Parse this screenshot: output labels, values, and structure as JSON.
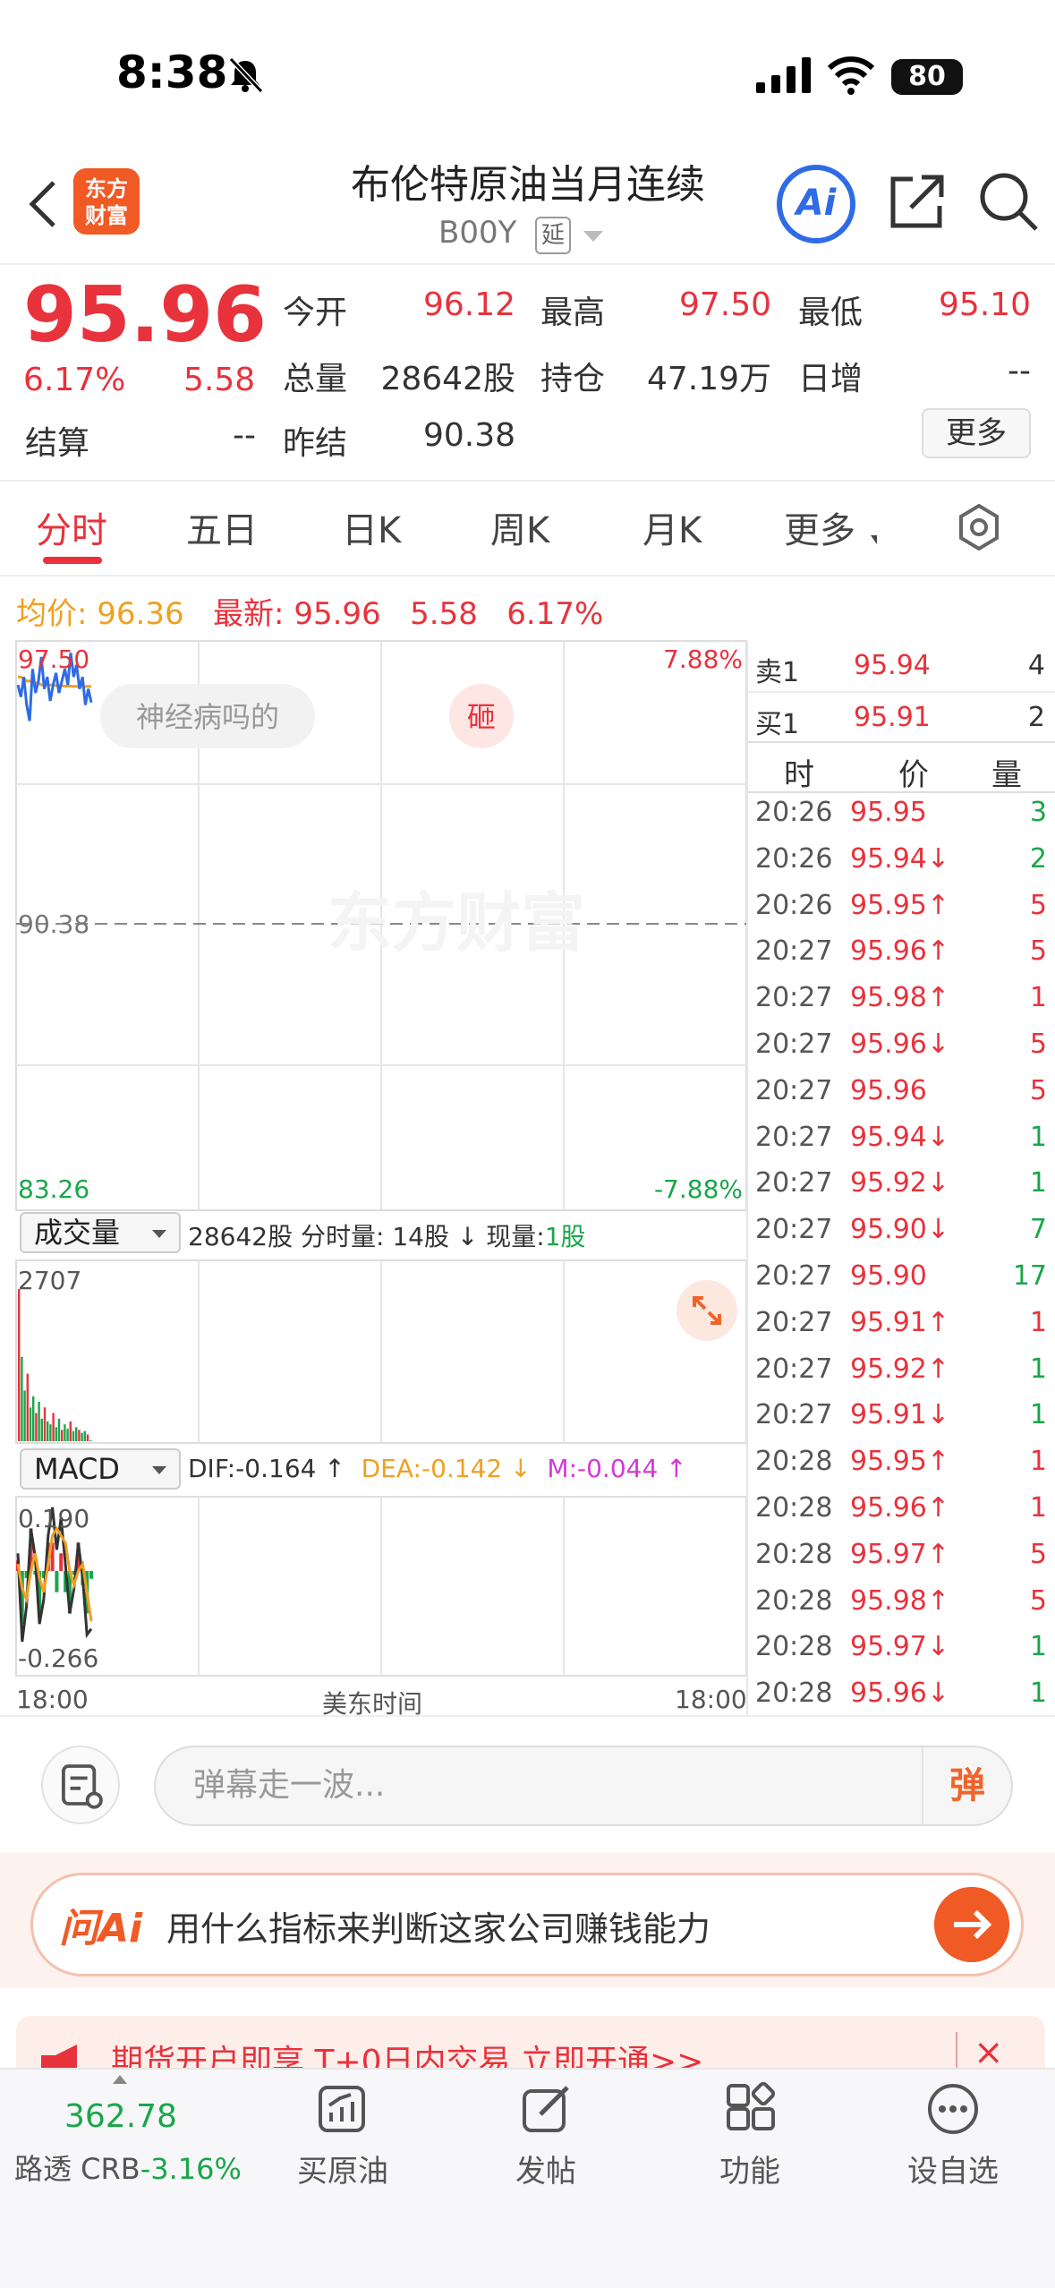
{
  "status": {
    "time": "8:38",
    "battery": "80"
  },
  "header": {
    "title": "布伦特原油当月连续",
    "code": "B00Y",
    "delay_badge": "延",
    "logo_line1": "东方",
    "logo_line2": "财富",
    "ai_label": "Ai"
  },
  "quote": {
    "price": "95.96",
    "change_pct": "6.17%",
    "change": "5.58",
    "fields": {
      "open_label": "今开",
      "open": "96.12",
      "high_label": "最高",
      "high": "97.50",
      "low_label": "最低",
      "low": "95.10",
      "volume_label": "总量",
      "volume": "28642股",
      "position_label": "持仓",
      "position": "47.19万",
      "daily_inc_label": "日增",
      "daily_inc": "--",
      "settle_label": "结算",
      "settle": "--",
      "prev_settle_label": "昨结",
      "prev_settle": "90.38"
    },
    "more_label": "更多"
  },
  "tabs": [
    "分时",
    "五日",
    "日K",
    "周K",
    "月K",
    "更多"
  ],
  "summary": {
    "avg_label": "均价:",
    "avg": "96.36",
    "latest_label": "最新:",
    "latest": "95.96",
    "change": "5.58",
    "change_pct": "6.17%"
  },
  "chart_labels": {
    "top_price": "97.50",
    "top_pct": "7.88%",
    "mid_price": "90.38",
    "bottom_price": "83.26",
    "bottom_pct": "-7.88%",
    "danmu_bubble_1": "神经病吗的",
    "danmu_bubble_2": "砸",
    "watermark": "东方财富",
    "vol_max": "2707",
    "macd_top": "0.190",
    "macd_bottom": "-0.266",
    "time_start": "18:00",
    "time_mid": "美东时间",
    "time_end": "18:00"
  },
  "volume_panel": {
    "selector": "成交量",
    "total": "28642股",
    "minute_label": "分时量:",
    "minute_vol": "14股",
    "arrow": "↓",
    "current_label": "现量:",
    "current_vol": "1股"
  },
  "macd_panel": {
    "selector": "MACD",
    "dif": "DIF:-0.164 ↑",
    "dea": "DEA:-0.142 ↓",
    "m": "M:-0.044 ↑"
  },
  "colors": {
    "up": "#e8323c",
    "down": "#1aa64a",
    "avg_line": "#f0a020",
    "price_line": "#2f6be6",
    "accent": "#f05a24"
  },
  "chart_data": {
    "type": "line",
    "title": "",
    "xlabel": "美东时间",
    "ylabel": "",
    "ylim": [
      83.26,
      97.5
    ],
    "x_ticks": [
      "18:00",
      "18:00"
    ],
    "series": [],
    "y_ticks": [
      "97.50",
      "90.38",
      "83.26"
    ],
    "pct_ticks": [
      "7.88%",
      "-7.88%"
    ],
    "price_path": [
      96.4,
      96.1,
      96.6,
      95.9,
      95.5,
      96.8,
      96.2,
      96.5,
      97.1,
      96.3,
      96.6,
      96.0,
      96.4,
      96.7,
      96.2,
      96.5,
      96.8,
      96.4,
      97.2,
      96.6,
      96.9,
      96.3,
      96.6,
      95.9,
      96.3,
      95.96
    ],
    "avg_path": [
      96.6,
      96.6,
      96.55,
      96.5,
      96.5,
      96.45,
      96.45,
      96.45,
      96.4,
      96.4,
      96.4,
      96.4,
      96.4,
      96.38,
      96.38,
      96.38,
      96.37,
      96.37,
      96.37,
      96.36,
      96.36,
      96.36,
      96.36,
      96.36,
      96.36,
      96.36
    ],
    "volume_path": [
      2707,
      1500,
      900,
      1200,
      600,
      800,
      500,
      700,
      400,
      600,
      350,
      300,
      500,
      250,
      400,
      200,
      300,
      220,
      350,
      180,
      250,
      200,
      150,
      180,
      120,
      14
    ],
    "volume_max": 2707,
    "macd_ylim": [
      -0.266,
      0.19
    ],
    "macd_dif": [
      0.05,
      -0.2,
      -0.1,
      0.12,
      0.04,
      -0.15,
      -0.08,
      0.1,
      0.18,
      0.06,
      0.15,
      0.02,
      -0.12,
      -0.05,
      0.08,
      -0.02,
      -0.18,
      -0.164
    ],
    "macd_dea": [
      0.02,
      -0.05,
      -0.08,
      0.0,
      0.05,
      -0.02,
      -0.06,
      0.02,
      0.1,
      0.12,
      0.1,
      0.08,
      0.0,
      -0.04,
      0.0,
      0.02,
      -0.06,
      -0.142
    ]
  },
  "order_book": {
    "ask_label": "卖1",
    "ask_price": "95.94",
    "ask_vol": "4",
    "bid_label": "买1",
    "bid_price": "95.91",
    "bid_vol": "2"
  },
  "ticks_header": {
    "time": "时",
    "price": "价",
    "vol": "量"
  },
  "ticks": [
    {
      "time": "20:26",
      "price": "95.95",
      "vol": "3",
      "dir": "",
      "vol_color": "green"
    },
    {
      "time": "20:26",
      "price": "95.94↓",
      "vol": "2",
      "dir": "down",
      "vol_color": "green"
    },
    {
      "time": "20:26",
      "price": "95.95↑",
      "vol": "5",
      "dir": "up",
      "vol_color": "red"
    },
    {
      "time": "20:27",
      "price": "95.96↑",
      "vol": "5",
      "dir": "up",
      "vol_color": "red"
    },
    {
      "time": "20:27",
      "price": "95.98↑",
      "vol": "1",
      "dir": "up",
      "vol_color": "red"
    },
    {
      "time": "20:27",
      "price": "95.96↓",
      "vol": "5",
      "dir": "down",
      "vol_color": "red"
    },
    {
      "time": "20:27",
      "price": "95.96",
      "vol": "5",
      "dir": "",
      "vol_color": "red"
    },
    {
      "time": "20:27",
      "price": "95.94↓",
      "vol": "1",
      "dir": "down",
      "vol_color": "green"
    },
    {
      "time": "20:27",
      "price": "95.92↓",
      "vol": "1",
      "dir": "down",
      "vol_color": "green"
    },
    {
      "time": "20:27",
      "price": "95.90↓",
      "vol": "7",
      "dir": "down",
      "vol_color": "green"
    },
    {
      "time": "20:27",
      "price": "95.90",
      "vol": "17",
      "dir": "",
      "vol_color": "green"
    },
    {
      "time": "20:27",
      "price": "95.91↑",
      "vol": "1",
      "dir": "up",
      "vol_color": "red"
    },
    {
      "time": "20:27",
      "price": "95.92↑",
      "vol": "1",
      "dir": "up",
      "vol_color": "green"
    },
    {
      "time": "20:27",
      "price": "95.91↓",
      "vol": "1",
      "dir": "down",
      "vol_color": "green"
    },
    {
      "time": "20:28",
      "price": "95.95↑",
      "vol": "1",
      "dir": "up",
      "vol_color": "red"
    },
    {
      "time": "20:28",
      "price": "95.96↑",
      "vol": "1",
      "dir": "up",
      "vol_color": "red"
    },
    {
      "time": "20:28",
      "price": "95.97↑",
      "vol": "5",
      "dir": "up",
      "vol_color": "red"
    },
    {
      "time": "20:28",
      "price": "95.98↑",
      "vol": "5",
      "dir": "up",
      "vol_color": "red"
    },
    {
      "time": "20:28",
      "price": "95.97↓",
      "vol": "1",
      "dir": "down",
      "vol_color": "green"
    },
    {
      "time": "20:28",
      "price": "95.96↓",
      "vol": "1",
      "dir": "down",
      "vol_color": "green"
    }
  ],
  "danmu": {
    "placeholder": "弹幕走一波...",
    "button": "弹"
  },
  "ask_ai": {
    "brand": "问Ai",
    "question": "用什么指标来判断这家公司赚钱能力"
  },
  "promo": {
    "text": "期货开户即享 T+0日内交易   立即开通>>",
    "close": "×"
  },
  "bottom_nav": {
    "index_value": "362.78",
    "index_name": "路透 CRB",
    "index_change": "-3.16%",
    "items": [
      "买原油",
      "发帖",
      "功能",
      "设自选"
    ]
  }
}
